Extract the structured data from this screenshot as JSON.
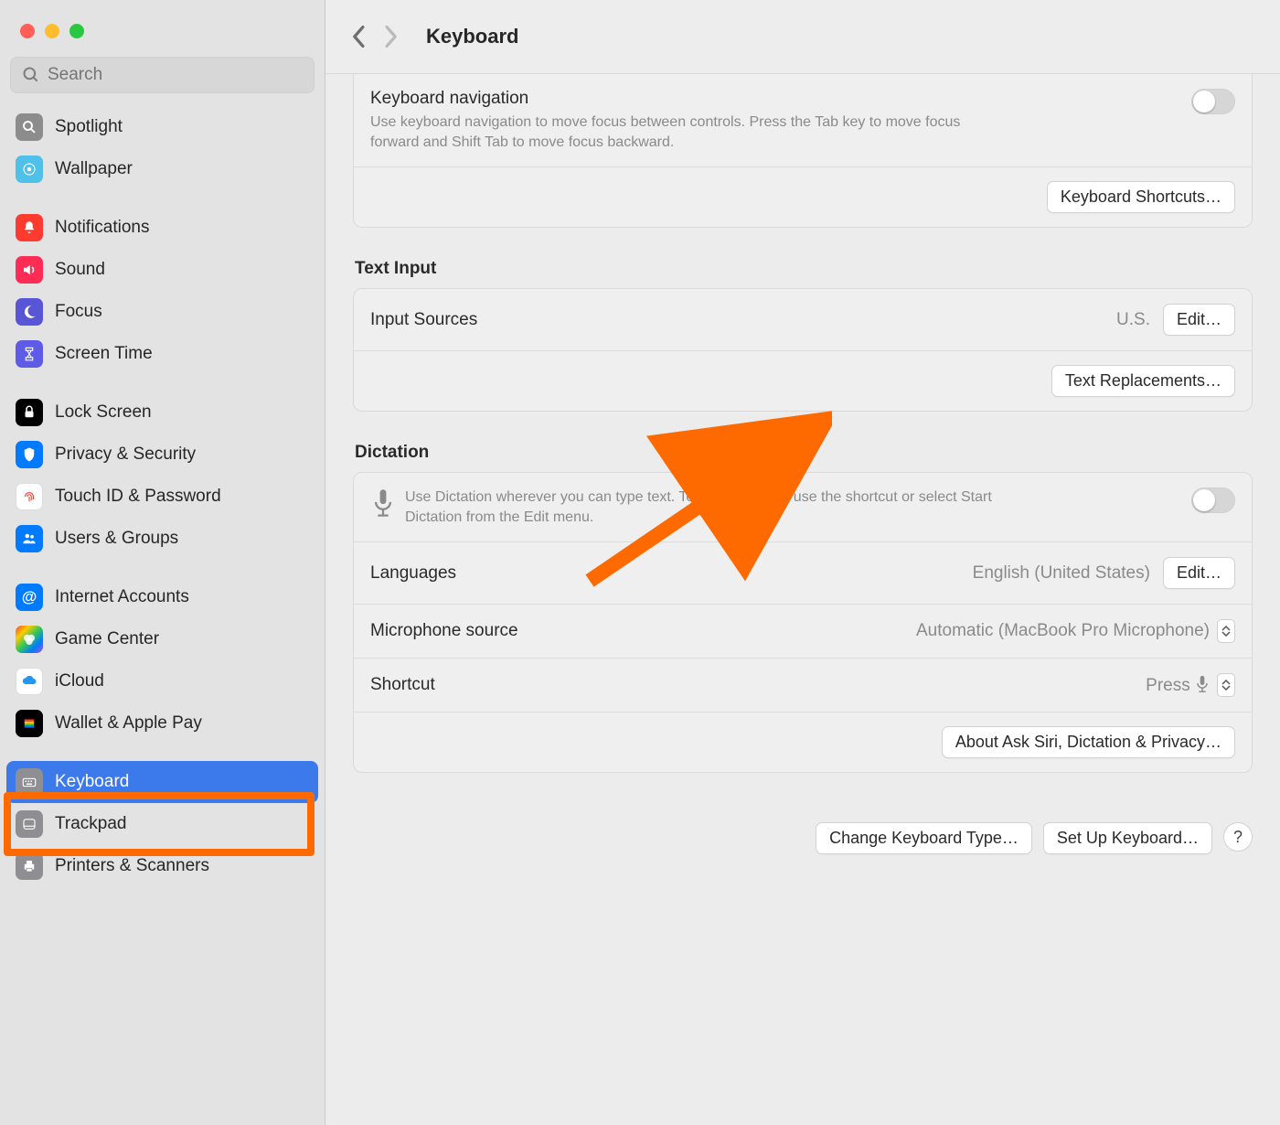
{
  "sidebar": {
    "search_placeholder": "Search",
    "items": [
      {
        "label": "Spotlight",
        "icon": "spotlight"
      },
      {
        "label": "Wallpaper",
        "icon": "wallpaper"
      },
      {
        "label": "Notifications",
        "icon": "notifications"
      },
      {
        "label": "Sound",
        "icon": "sound"
      },
      {
        "label": "Focus",
        "icon": "focus"
      },
      {
        "label": "Screen Time",
        "icon": "screentime"
      },
      {
        "label": "Lock Screen",
        "icon": "lock"
      },
      {
        "label": "Privacy & Security",
        "icon": "privacy"
      },
      {
        "label": "Touch ID & Password",
        "icon": "touchid"
      },
      {
        "label": "Users & Groups",
        "icon": "users"
      },
      {
        "label": "Internet Accounts",
        "icon": "internet"
      },
      {
        "label": "Game Center",
        "icon": "gamecenter"
      },
      {
        "label": "iCloud",
        "icon": "icloud"
      },
      {
        "label": "Wallet & Apple Pay",
        "icon": "wallet"
      },
      {
        "label": "Keyboard",
        "icon": "keyboard",
        "selected": true
      },
      {
        "label": "Trackpad",
        "icon": "trackpad"
      },
      {
        "label": "Printers & Scanners",
        "icon": "printers"
      }
    ]
  },
  "header": {
    "title": "Keyboard"
  },
  "kb_nav": {
    "title": "Keyboard navigation",
    "description": "Use keyboard navigation to move focus between controls. Press the Tab key to move focus forward and Shift Tab to move focus backward.",
    "toggle_on": false,
    "shortcuts_button": "Keyboard Shortcuts…"
  },
  "text_input": {
    "section": "Text Input",
    "input_sources_label": "Input Sources",
    "input_sources_value": "U.S.",
    "edit_button": "Edit…",
    "text_replacements_button": "Text Replacements…"
  },
  "dictation": {
    "section": "Dictation",
    "description": "Use Dictation wherever you can type text. To start dictating, use the shortcut or select Start Dictation from the Edit menu.",
    "toggle_on": false,
    "languages_label": "Languages",
    "languages_value": "English (United States)",
    "languages_edit": "Edit…",
    "mic_label": "Microphone source",
    "mic_value": "Automatic (MacBook Pro Microphone)",
    "shortcut_label": "Shortcut",
    "shortcut_value": "Press ",
    "about_button": "About Ask Siri, Dictation & Privacy…"
  },
  "footer": {
    "change_type": "Change Keyboard Type…",
    "setup": "Set Up Keyboard…",
    "help": "?"
  }
}
